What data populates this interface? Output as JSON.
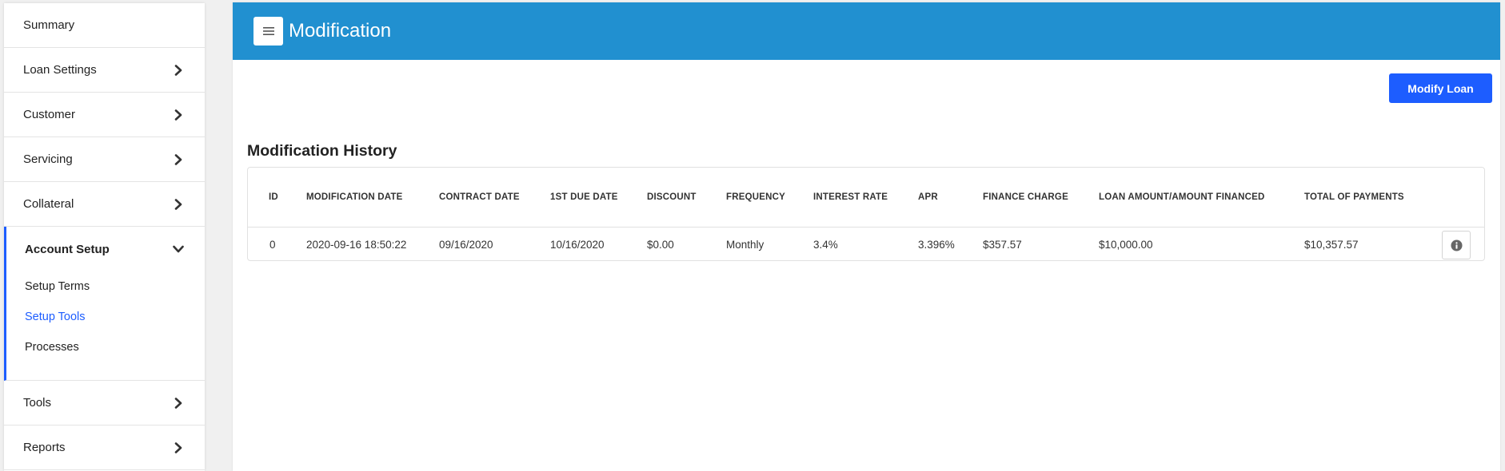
{
  "sidebar": {
    "items": [
      {
        "label": "Summary"
      },
      {
        "label": "Loan Settings"
      },
      {
        "label": "Customer"
      },
      {
        "label": "Servicing"
      },
      {
        "label": "Collateral"
      }
    ],
    "account_setup": {
      "label": "Account Setup",
      "sub_items": [
        {
          "label": "Setup Terms"
        },
        {
          "label": "Setup Tools"
        },
        {
          "label": "Processes"
        }
      ]
    },
    "bottom_items": [
      {
        "label": "Tools"
      },
      {
        "label": "Reports"
      }
    ]
  },
  "header": {
    "title": "Modification",
    "menu_icon": "hamburger-icon",
    "color": "#2190d0"
  },
  "actions": {
    "modify_loan_label": "Modify Loan",
    "accent_color": "#1d5dff"
  },
  "history": {
    "title": "Modification History",
    "columns": [
      "ID",
      "MODIFICATION DATE",
      "CONTRACT DATE",
      "1ST DUE DATE",
      "DISCOUNT",
      "FREQUENCY",
      "INTEREST RATE",
      "APR",
      "FINANCE CHARGE",
      "LOAN AMOUNT/AMOUNT FINANCED",
      "TOTAL OF PAYMENTS"
    ],
    "rows": [
      [
        "0",
        "2020-09-16 18:50:22",
        "09/16/2020",
        "10/16/2020",
        "$0.00",
        "Monthly",
        "3.4%",
        "3.396%",
        "$357.57",
        "$10,000.00",
        "$10,357.57"
      ]
    ],
    "row_action_icon": "info-icon"
  }
}
